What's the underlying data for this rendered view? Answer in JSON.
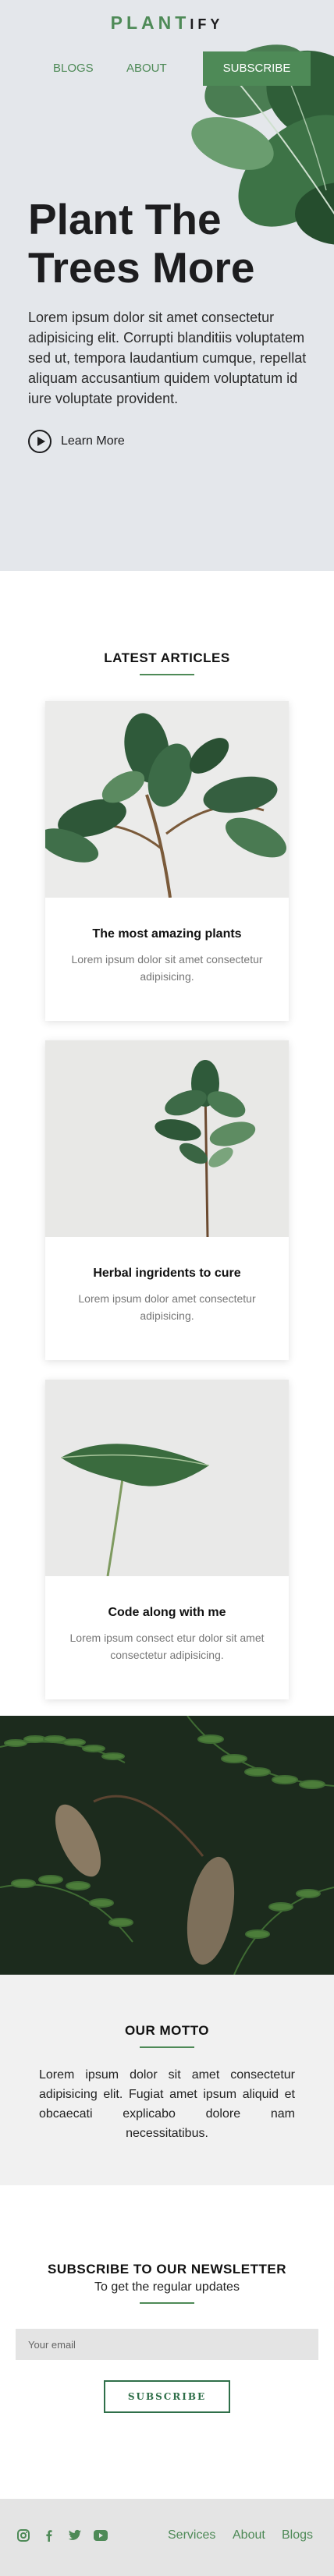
{
  "brand": {
    "part1": "PLANT",
    "part2": "IFY"
  },
  "nav": {
    "blogs": "BLOGS",
    "about": "ABOUT",
    "subscribe": "SUBSCRIBE"
  },
  "hero": {
    "title": "Plant The Trees More",
    "body": "Lorem ipsum dolor sit amet consectetur adipisicing elit. Corrupti blanditiis voluptatem sed ut, tempora laudantium cumque, repellat aliquam accusantium quidem voluptatum id iure voluptate provident.",
    "learn_more": "Learn More"
  },
  "articles": {
    "title": "LATEST ARTICLES",
    "items": [
      {
        "title": "The most amazing plants",
        "text": "Lorem ipsum dolor sit amet consectetur adipisicing."
      },
      {
        "title": "Herbal ingridents to cure",
        "text": "Lorem ipsum dolor amet consectetur adipisicing."
      },
      {
        "title": "Code along with me",
        "text": "Lorem ipsum consect etur dolor sit amet consectetur adipisicing."
      }
    ]
  },
  "motto": {
    "title": "OUR MOTTO",
    "text": "Lorem ipsum dolor sit amet consectetur adipisicing elit. Fugiat amet ipsum aliquid et obcaecati explicabo dolore nam necessitatibus."
  },
  "newsletter": {
    "title": "SUBSCRIBE TO OUR NEWSLETTER",
    "subtitle": "To get the regular updates",
    "email_placeholder": "Your email",
    "button": "SUBSCRIBE"
  },
  "footer": {
    "social": [
      "instagram-icon",
      "facebook-icon",
      "twitter-icon",
      "youtube-icon"
    ],
    "links": {
      "services": "Services",
      "about": "About",
      "blogs": "Blogs"
    }
  },
  "colors": {
    "accent": "#4e8a57",
    "dark_green": "#2f6f49",
    "hero_bg": "#e4e7eb"
  }
}
